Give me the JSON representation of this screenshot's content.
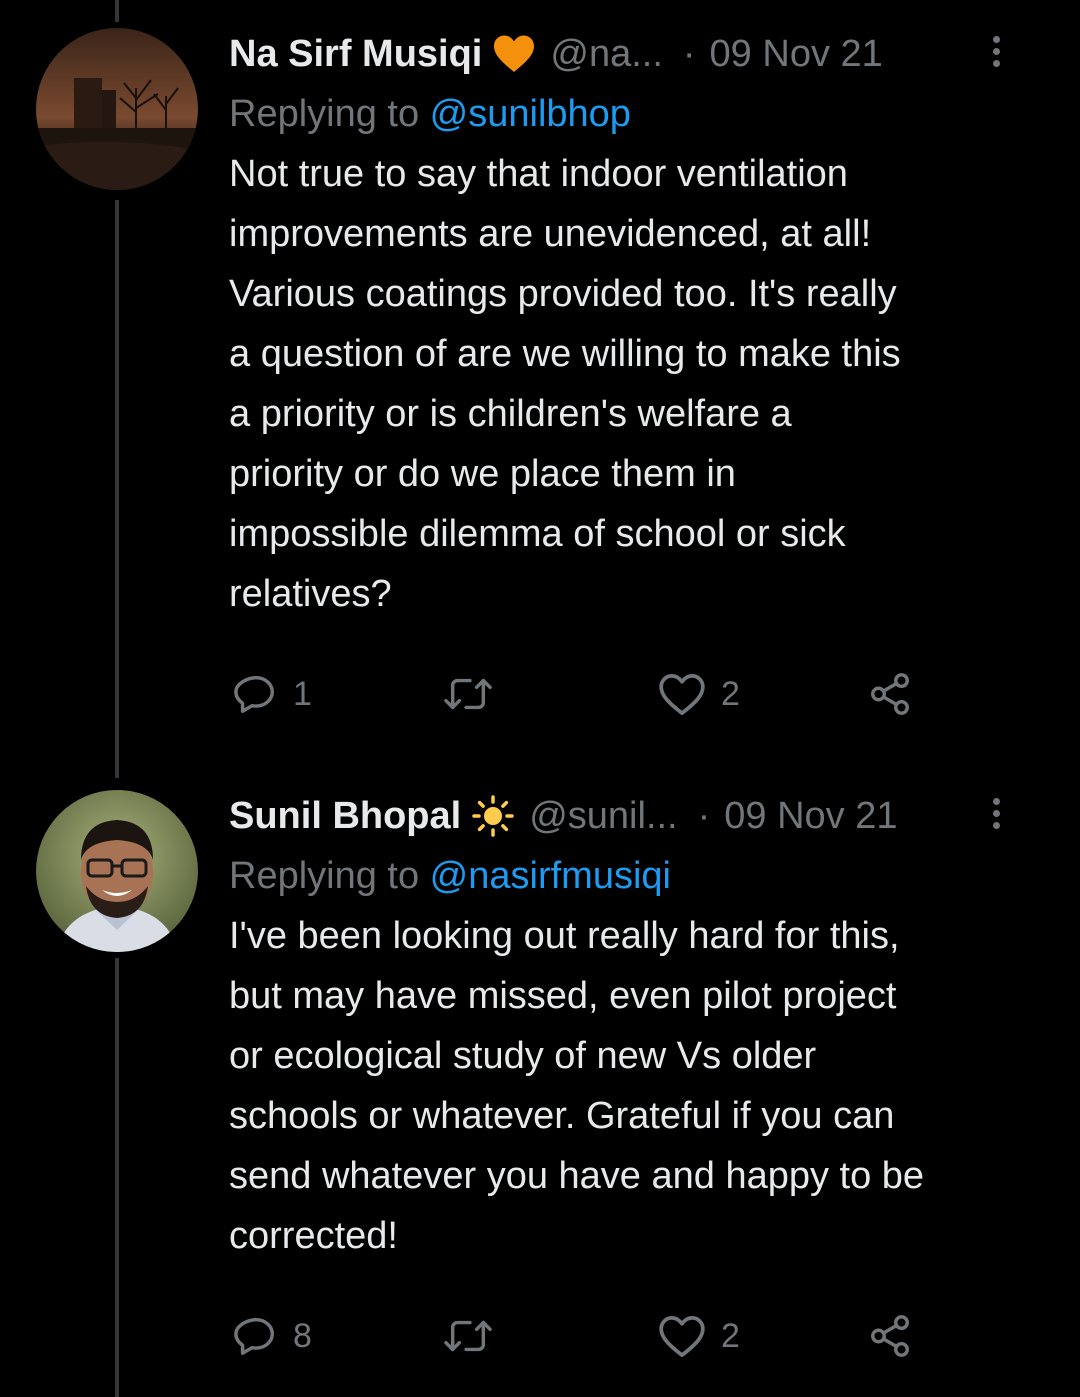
{
  "tweets": [
    {
      "display_name": "Na Sirf Musiqi",
      "badge_icon": "orange-heart-icon",
      "handle": "@na...",
      "separator": "·",
      "date": "09 Nov 21",
      "replying_prefix": "Replying to ",
      "replying_to": "@sunilbhop",
      "text": "Not true to say that indoor ventilation\nimprovements are unevidenced, at all!\nVarious coatings provided too. It's really\na question of are we willing to make this\na priority or is children's welfare a\npriority or do we place them in\nimpossible dilemma of school or sick\nrelatives?",
      "replies": "1",
      "retweets": "",
      "likes": "2"
    },
    {
      "display_name": "Sunil Bhopal",
      "badge_icon": "sun-icon",
      "handle": "@sunil...",
      "separator": "·",
      "date": "09 Nov 21",
      "replying_prefix": "Replying to ",
      "replying_to": "@nasirfmusiqi",
      "text": "I've been looking out really hard for this,\nbut may have missed, even pilot project\nor ecological study of new Vs older\nschools or whatever. Grateful if you can\nsend whatever you have and happy to be\ncorrected!",
      "replies": "8",
      "retweets": "",
      "likes": "2"
    }
  ],
  "colors": {
    "background": "#000000",
    "text": "#e7e9ea",
    "secondary": "#71767b",
    "link": "#1d9bf0",
    "thread_line": "#333639",
    "heart_badge": "#f4900c",
    "sun_badge": "#ffcc4d"
  }
}
